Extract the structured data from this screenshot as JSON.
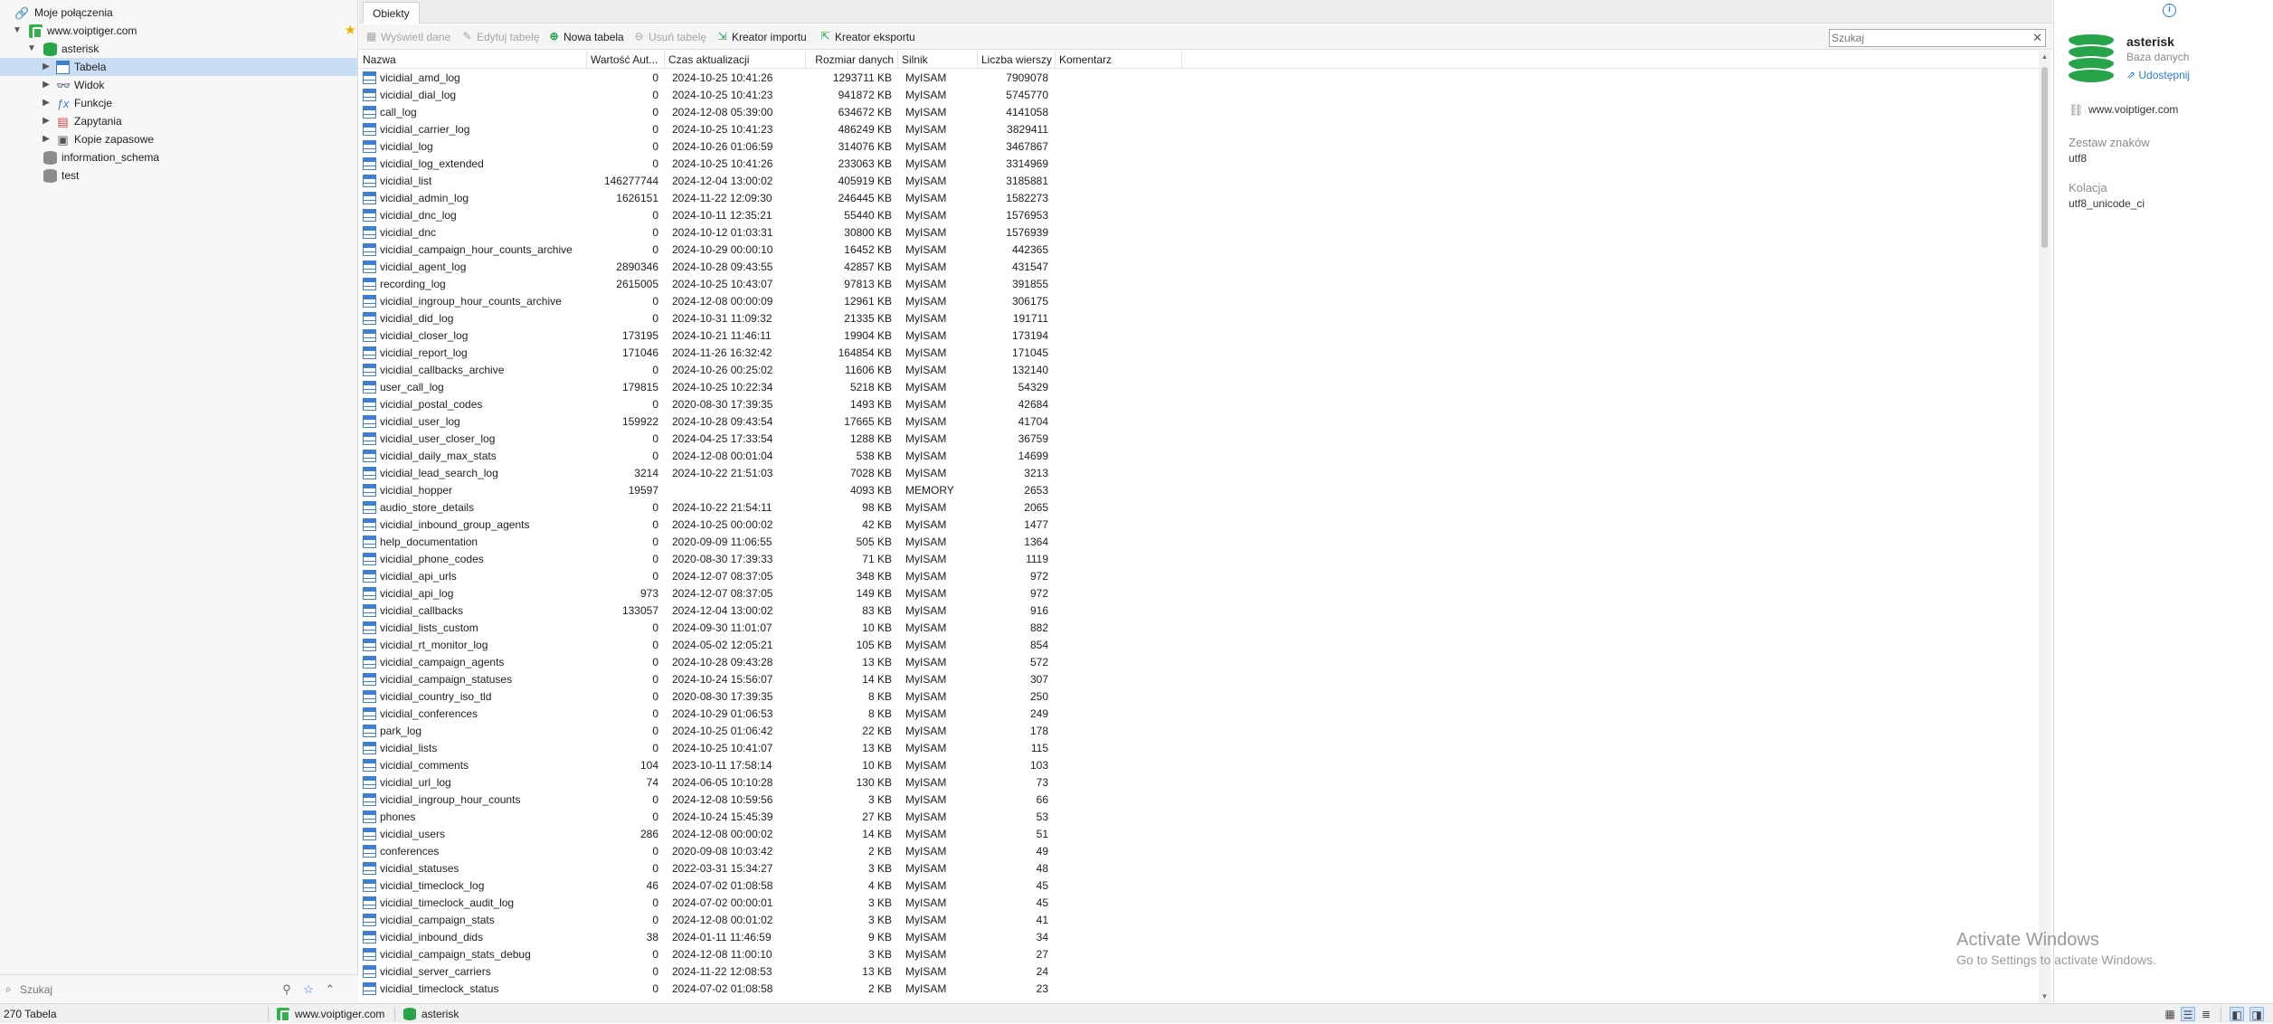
{
  "sidebar": {
    "root_label": "Moje połączenia",
    "connection": "www.voiptiger.com",
    "database": "asterisk",
    "items": [
      {
        "label": "Tabela",
        "icon": "table-icon"
      },
      {
        "label": "Widok",
        "icon": "view-icon"
      },
      {
        "label": "Funkcje",
        "icon": "function-icon"
      },
      {
        "label": "Zapytania",
        "icon": "query-icon"
      },
      {
        "label": "Kopie zapasowe",
        "icon": "backup-icon"
      }
    ],
    "other_databases": [
      "information_schema",
      "test"
    ],
    "search_placeholder": "Szukaj"
  },
  "main": {
    "tab_label": "Obiekty",
    "toolbar": {
      "view_data": "Wyświetl dane",
      "edit_table": "Edytuj tabelę",
      "new_table": "Nowa tabela",
      "delete_table": "Usuń tabelę",
      "import_wizard": "Kreator importu",
      "export_wizard": "Kreator eksportu",
      "search_placeholder": "Szukaj"
    },
    "columns": {
      "name": "Nazwa",
      "auto_inc": "Wartość Aut...",
      "updated": "Czas aktualizacji",
      "data_size": "Rozmiar danych",
      "engine": "Silnik",
      "row_count": "Liczba wierszy",
      "comment": "Komentarz"
    },
    "rows": [
      [
        "vicidial_amd_log",
        "0",
        "2024-10-25 10:41:26",
        "1293711 KB",
        "MyISAM",
        "7909078"
      ],
      [
        "vicidial_dial_log",
        "0",
        "2024-10-25 10:41:23",
        "941872 KB",
        "MyISAM",
        "5745770"
      ],
      [
        "call_log",
        "0",
        "2024-12-08 05:39:00",
        "634672 KB",
        "MyISAM",
        "4141058"
      ],
      [
        "vicidial_carrier_log",
        "0",
        "2024-10-25 10:41:23",
        "486249 KB",
        "MyISAM",
        "3829411"
      ],
      [
        "vicidial_log",
        "0",
        "2024-10-26 01:06:59",
        "314076 KB",
        "MyISAM",
        "3467867"
      ],
      [
        "vicidial_log_extended",
        "0",
        "2024-10-25 10:41:26",
        "233063 KB",
        "MyISAM",
        "3314969"
      ],
      [
        "vicidial_list",
        "146277744",
        "2024-12-04 13:00:02",
        "405919 KB",
        "MyISAM",
        "3185881"
      ],
      [
        "vicidial_admin_log",
        "1626151",
        "2024-11-22 12:09:30",
        "246445 KB",
        "MyISAM",
        "1582273"
      ],
      [
        "vicidial_dnc_log",
        "0",
        "2024-10-11 12:35:21",
        "55440 KB",
        "MyISAM",
        "1576953"
      ],
      [
        "vicidial_dnc",
        "0",
        "2024-10-12 01:03:31",
        "30800 KB",
        "MyISAM",
        "1576939"
      ],
      [
        "vicidial_campaign_hour_counts_archive",
        "0",
        "2024-10-29 00:00:10",
        "16452 KB",
        "MyISAM",
        "442365"
      ],
      [
        "vicidial_agent_log",
        "2890346",
        "2024-10-28 09:43:55",
        "42857 KB",
        "MyISAM",
        "431547"
      ],
      [
        "recording_log",
        "2615005",
        "2024-10-25 10:43:07",
        "97813 KB",
        "MyISAM",
        "391855"
      ],
      [
        "vicidial_ingroup_hour_counts_archive",
        "0",
        "2024-12-08 00:00:09",
        "12961 KB",
        "MyISAM",
        "306175"
      ],
      [
        "vicidial_did_log",
        "0",
        "2024-10-31 11:09:32",
        "21335 KB",
        "MyISAM",
        "191711"
      ],
      [
        "vicidial_closer_log",
        "173195",
        "2024-10-21 11:46:11",
        "19904 KB",
        "MyISAM",
        "173194"
      ],
      [
        "vicidial_report_log",
        "171046",
        "2024-11-26 16:32:42",
        "164854 KB",
        "MyISAM",
        "171045"
      ],
      [
        "vicidial_callbacks_archive",
        "0",
        "2024-10-26 00:25:02",
        "11606 KB",
        "MyISAM",
        "132140"
      ],
      [
        "user_call_log",
        "179815",
        "2024-10-25 10:22:34",
        "5218 KB",
        "MyISAM",
        "54329"
      ],
      [
        "vicidial_postal_codes",
        "0",
        "2020-08-30 17:39:35",
        "1493 KB",
        "MyISAM",
        "42684"
      ],
      [
        "vicidial_user_log",
        "159922",
        "2024-10-28 09:43:54",
        "17665 KB",
        "MyISAM",
        "41704"
      ],
      [
        "vicidial_user_closer_log",
        "0",
        "2024-04-25 17:33:54",
        "1288 KB",
        "MyISAM",
        "36759"
      ],
      [
        "vicidial_daily_max_stats",
        "0",
        "2024-12-08 00:01:04",
        "538 KB",
        "MyISAM",
        "14699"
      ],
      [
        "vicidial_lead_search_log",
        "3214",
        "2024-10-22 21:51:03",
        "7028 KB",
        "MyISAM",
        "3213"
      ],
      [
        "vicidial_hopper",
        "19597",
        "",
        "4093 KB",
        "MEMORY",
        "2653"
      ],
      [
        "audio_store_details",
        "0",
        "2024-10-22 21:54:11",
        "98 KB",
        "MyISAM",
        "2065"
      ],
      [
        "vicidial_inbound_group_agents",
        "0",
        "2024-10-25 00:00:02",
        "42 KB",
        "MyISAM",
        "1477"
      ],
      [
        "help_documentation",
        "0",
        "2020-09-09 11:06:55",
        "505 KB",
        "MyISAM",
        "1364"
      ],
      [
        "vicidial_phone_codes",
        "0",
        "2020-08-30 17:39:33",
        "71 KB",
        "MyISAM",
        "1119"
      ],
      [
        "vicidial_api_urls",
        "0",
        "2024-12-07 08:37:05",
        "348 KB",
        "MyISAM",
        "972"
      ],
      [
        "vicidial_api_log",
        "973",
        "2024-12-07 08:37:05",
        "149 KB",
        "MyISAM",
        "972"
      ],
      [
        "vicidial_callbacks",
        "133057",
        "2024-12-04 13:00:02",
        "83 KB",
        "MyISAM",
        "916"
      ],
      [
        "vicidial_lists_custom",
        "0",
        "2024-09-30 11:01:07",
        "10 KB",
        "MyISAM",
        "882"
      ],
      [
        "vicidial_rt_monitor_log",
        "0",
        "2024-05-02 12:05:21",
        "105 KB",
        "MyISAM",
        "854"
      ],
      [
        "vicidial_campaign_agents",
        "0",
        "2024-10-28 09:43:28",
        "13 KB",
        "MyISAM",
        "572"
      ],
      [
        "vicidial_campaign_statuses",
        "0",
        "2024-10-24 15:56:07",
        "14 KB",
        "MyISAM",
        "307"
      ],
      [
        "vicidial_country_iso_tld",
        "0",
        "2020-08-30 17:39:35",
        "8 KB",
        "MyISAM",
        "250"
      ],
      [
        "vicidial_conferences",
        "0",
        "2024-10-29 01:06:53",
        "8 KB",
        "MyISAM",
        "249"
      ],
      [
        "park_log",
        "0",
        "2024-10-25 01:06:42",
        "22 KB",
        "MyISAM",
        "178"
      ],
      [
        "vicidial_lists",
        "0",
        "2024-10-25 10:41:07",
        "13 KB",
        "MyISAM",
        "115"
      ],
      [
        "vicidial_comments",
        "104",
        "2023-10-11 17:58:14",
        "10 KB",
        "MyISAM",
        "103"
      ],
      [
        "vicidial_url_log",
        "74",
        "2024-06-05 10:10:28",
        "130 KB",
        "MyISAM",
        "73"
      ],
      [
        "vicidial_ingroup_hour_counts",
        "0",
        "2024-12-08 10:59:56",
        "3 KB",
        "MyISAM",
        "66"
      ],
      [
        "phones",
        "0",
        "2024-10-24 15:45:39",
        "27 KB",
        "MyISAM",
        "53"
      ],
      [
        "vicidial_users",
        "286",
        "2024-12-08 00:00:02",
        "14 KB",
        "MyISAM",
        "51"
      ],
      [
        "conferences",
        "0",
        "2020-09-08 10:03:42",
        "2 KB",
        "MyISAM",
        "49"
      ],
      [
        "vicidial_statuses",
        "0",
        "2022-03-31 15:34:27",
        "3 KB",
        "MyISAM",
        "48"
      ],
      [
        "vicidial_timeclock_log",
        "46",
        "2024-07-02 01:08:58",
        "4 KB",
        "MyISAM",
        "45"
      ],
      [
        "vicidial_timeclock_audit_log",
        "0",
        "2024-07-02 00:00:01",
        "3 KB",
        "MyISAM",
        "45"
      ],
      [
        "vicidial_campaign_stats",
        "0",
        "2024-12-08 00:01:02",
        "3 KB",
        "MyISAM",
        "41"
      ],
      [
        "vicidial_inbound_dids",
        "38",
        "2024-01-11 11:46:59",
        "9 KB",
        "MyISAM",
        "34"
      ],
      [
        "vicidial_campaign_stats_debug",
        "0",
        "2024-12-08 11:00:10",
        "3 KB",
        "MyISAM",
        "27"
      ],
      [
        "vicidial_server_carriers",
        "0",
        "2024-11-22 12:08:53",
        "13 KB",
        "MyISAM",
        "24"
      ],
      [
        "vicidial_timeclock_status",
        "0",
        "2024-07-02 01:08:58",
        "2 KB",
        "MyISAM",
        "23"
      ]
    ]
  },
  "info_panel": {
    "title": "asterisk",
    "subtitle": "Baza danych",
    "share_link": "Udostępnij",
    "host": "www.voiptiger.com",
    "charset_label": "Zestaw znaków",
    "charset_value": "utf8",
    "collation_label": "Kolacja",
    "collation_value": "utf8_unicode_ci"
  },
  "watermark": {
    "line1": "Activate Windows",
    "line2": "Go to Settings to activate Windows."
  },
  "status": {
    "count": "270 Tabela",
    "connection": "www.voiptiger.com",
    "database": "asterisk"
  },
  "colors": {
    "accent": "#2f7ad6",
    "connection_green": "#2fb34a",
    "selection": "#c9ddf4"
  }
}
